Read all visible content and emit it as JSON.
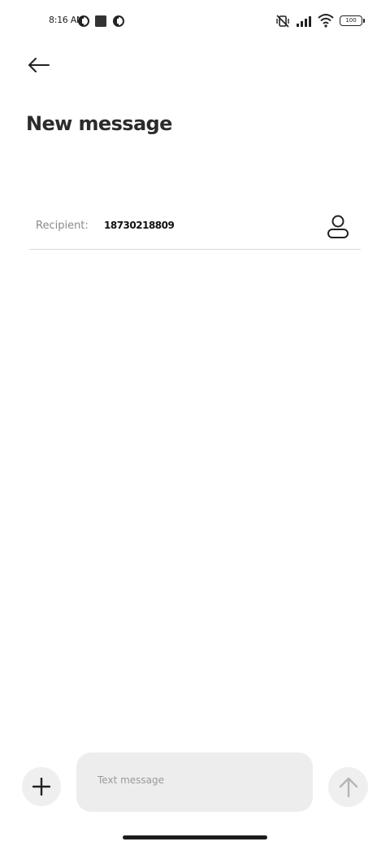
{
  "status_bar": {
    "time": "8:16 AM",
    "battery_level": "100",
    "left_icons": [
      "app-notification-icon",
      "square-notification-icon",
      "app-notification-icon"
    ],
    "right_icons": [
      "vibrate-off-icon",
      "signal-icon",
      "wifi-icon",
      "battery-icon"
    ]
  },
  "header": {
    "back_icon": "arrow-left-icon",
    "title": "New message"
  },
  "recipient": {
    "label": "Recipient:",
    "value": "18730218809",
    "contact_icon": "person-icon"
  },
  "composer": {
    "attach_icon": "plus-icon",
    "placeholder": "Text message",
    "value": "",
    "send_icon": "arrow-up-icon"
  },
  "colors": {
    "background": "#ffffff",
    "button_bg": "#efefef",
    "input_bg": "#ededed",
    "label_gray": "#8a8a8a",
    "divider": "#d9d9d9"
  }
}
